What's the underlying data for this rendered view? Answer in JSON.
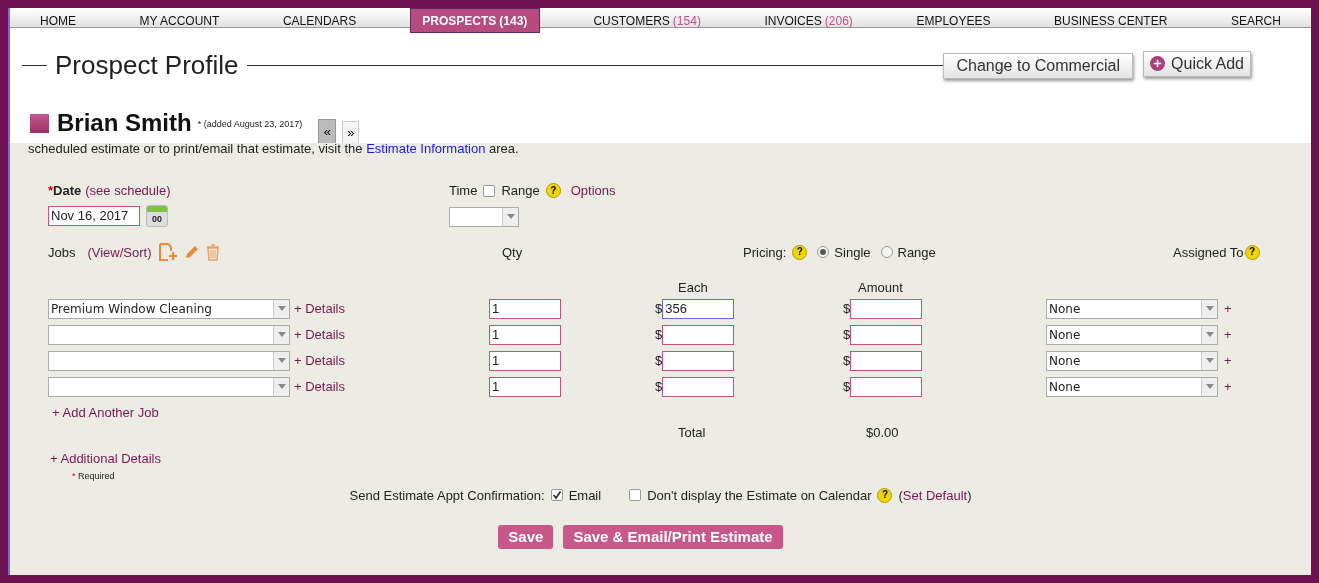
{
  "nav": [
    {
      "label": "HOME",
      "selected": false
    },
    {
      "label": "MY ACCOUNT",
      "selected": false
    },
    {
      "label": "CALENDARS",
      "selected": false
    },
    {
      "label": "PROSPECTS",
      "count": "(143)",
      "selected": true
    },
    {
      "label": "CUSTOMERS",
      "count": "(154)",
      "selected": false
    },
    {
      "label": "INVOICES",
      "count": "(206)",
      "selected": false
    },
    {
      "label": "EMPLOYEES",
      "selected": false
    },
    {
      "label": "BUSINESS CENTER",
      "selected": false
    },
    {
      "label": "SEARCH",
      "selected": false
    }
  ],
  "header": {
    "title": "Prospect Profile",
    "change_button": "Change to Commercial",
    "quick_add": "Quick Add"
  },
  "prospect": {
    "name": "Brian Smith",
    "added_mark": "*",
    "added": "(added August 23, 2017)",
    "prev": "«",
    "next": "»"
  },
  "info": {
    "before": "scheduled estimate or to print/email that estimate, visit the",
    "link": "Estimate Information",
    "after": "area."
  },
  "date": {
    "required_mark": "*",
    "label": "Date",
    "link": "(see schedule)",
    "value": "Nov 16, 2017",
    "calendar_day": "00"
  },
  "time": {
    "label": "Time",
    "range_label": "Range",
    "range_checked": false,
    "options": "Options"
  },
  "jobs": {
    "label": "Jobs",
    "link": "(View/Sort)"
  },
  "qty_label": "Qty",
  "pricing": {
    "label": "Pricing:",
    "options": [
      {
        "label": "Single",
        "selected": true
      },
      {
        "label": "Range",
        "selected": false
      }
    ]
  },
  "assigned_label": "Assigned To",
  "each_label": "Each",
  "amount_label": "Amount",
  "rows": [
    {
      "job": "Premium Window Cleaning",
      "details": "+ Details",
      "qty": "1",
      "each": "356",
      "amount": "",
      "assigned": "None",
      "focused": true
    },
    {
      "job": "",
      "details": "+ Details",
      "qty": "1",
      "each": "",
      "amount": "",
      "assigned": "None",
      "focused": false
    },
    {
      "job": "",
      "details": "+ Details",
      "qty": "1",
      "each": "",
      "amount": "",
      "assigned": "None",
      "focused": false
    },
    {
      "job": "",
      "details": "+ Details",
      "qty": "1",
      "each": "",
      "amount": "",
      "assigned": "None",
      "focused": false
    }
  ],
  "currency": "$",
  "assign_add": "+",
  "add_job": "+ Add Another Job",
  "total_label": "Total",
  "total_value": "$0.00",
  "additional_details": "+ Additional Details",
  "required_note": {
    "mark": "*",
    "text": "Required"
  },
  "confirmation": {
    "label": "Send Estimate Appt Confirmation:",
    "email_label": "Email",
    "email_checked": true,
    "hide_label": "Don't display the Estimate on Calendar",
    "hide_checked": false,
    "set_default_open": "(",
    "set_default": "Set Default",
    "set_default_close": ")"
  },
  "buttons": [
    "Save",
    "Save & Email/Print Estimate"
  ],
  "help": "?"
}
